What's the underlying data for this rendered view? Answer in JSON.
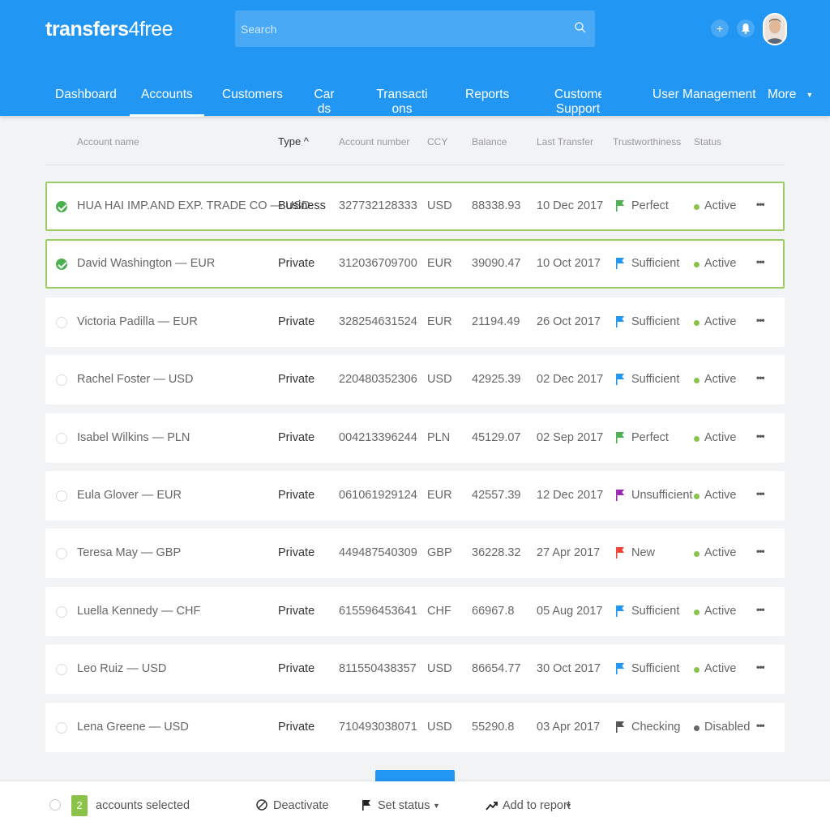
{
  "header": {
    "logo_part1": "transfers",
    "logo_part2": "4free",
    "search_placeholder": "Search",
    "add_label": "+",
    "accent": "#2196f3"
  },
  "nav": {
    "items": [
      {
        "label": "Dashboard"
      },
      {
        "label": "Accounts"
      },
      {
        "label": "Customers"
      },
      {
        "label": "Cards"
      },
      {
        "label": "Transactions"
      },
      {
        "label": "Reports"
      },
      {
        "label": "Customer Support"
      },
      {
        "label": "User Management"
      },
      {
        "label": "More"
      }
    ],
    "active": "Accounts"
  },
  "table": {
    "columns": [
      "Account name",
      "Type ^",
      "Account number",
      "CCY",
      "Balance",
      "Last Transfer",
      "Trustworthiness",
      "Status"
    ],
    "rows": [
      {
        "selected": true,
        "name": "HUA HAI IMP.AND EXP. TRADE CO — USD",
        "type": "Business",
        "number": "327732128333",
        "ccy": "USD",
        "balance": "88338.93",
        "last": "10 Dec 2017",
        "trust": "Perfect",
        "flag": "#4caf50",
        "status": "Active",
        "status_color": "#8bc34a",
        "more": "•••"
      },
      {
        "selected": true,
        "name": "David Washington — EUR",
        "type": "Private",
        "number": "312036709700",
        "ccy": "EUR",
        "balance": "39090.47",
        "last": "10 Oct 2017",
        "trust": "Sufficient",
        "flag": "#2196f3",
        "status": "Active",
        "status_color": "#8bc34a",
        "more": "•••"
      },
      {
        "selected": false,
        "name": "Victoria Padilla — EUR",
        "type": "Private",
        "number": "328254631524",
        "ccy": "EUR",
        "balance": "21194.49",
        "last": "26 Oct 2017",
        "trust": "Sufficient",
        "flag": "#2196f3",
        "status": "Active",
        "status_color": "#8bc34a",
        "more": "•••"
      },
      {
        "selected": false,
        "name": "Rachel Foster — USD",
        "type": "Private",
        "number": "220480352306",
        "ccy": "USD",
        "balance": "42925.39",
        "last": "02 Dec 2017",
        "trust": "Sufficient",
        "flag": "#2196f3",
        "status": "Active",
        "status_color": "#8bc34a",
        "more": "•••"
      },
      {
        "selected": false,
        "name": "Isabel Wilkins — PLN",
        "type": "Private",
        "number": "004213396244",
        "ccy": "PLN",
        "balance": "45129.07",
        "last": "02 Sep 2017",
        "trust": "Perfect",
        "flag": "#4caf50",
        "status": "Active",
        "status_color": "#8bc34a",
        "more": "•••"
      },
      {
        "selected": false,
        "name": "Eula Glover — EUR",
        "type": "Private",
        "number": "061061929124",
        "ccy": "EUR",
        "balance": "42557.39",
        "last": "12 Dec 2017",
        "trust": "Unsufficient",
        "flag": "#9c27b0",
        "status": "Active",
        "status_color": "#8bc34a",
        "more": "•••"
      },
      {
        "selected": false,
        "name": "Teresa May — GBP",
        "type": "Private",
        "number": "449487540309",
        "ccy": "GBP",
        "balance": "36228.32",
        "last": "27 Apr 2017",
        "trust": "New",
        "flag": "#f44336",
        "status": "Active",
        "status_color": "#8bc34a",
        "more": "•••"
      },
      {
        "selected": false,
        "name": "Luella Kennedy — CHF",
        "type": "Private",
        "number": "615596453641",
        "ccy": "CHF",
        "balance": "66967.8",
        "last": "05 Aug 2017",
        "trust": "Sufficient",
        "flag": "#2196f3",
        "status": "Active",
        "status_color": "#8bc34a",
        "more": "•••"
      },
      {
        "selected": false,
        "name": "Leo Ruiz — USD",
        "type": "Private",
        "number": "811550438357",
        "ccy": "USD",
        "balance": "86654.77",
        "last": "30 Oct 2017",
        "trust": "Sufficient",
        "flag": "#2196f3",
        "status": "Active",
        "status_color": "#8bc34a",
        "more": "•••"
      },
      {
        "selected": false,
        "name": "Lena Greene — USD",
        "type": "Private",
        "number": "710493038071",
        "ccy": "USD",
        "balance": "55290.8",
        "last": "03 Apr 2017",
        "trust": "Checking",
        "flag": "#555555",
        "status": "Disabled",
        "status_color": "#666666",
        "more": "•••"
      }
    ]
  },
  "bottom": {
    "count": "2",
    "selected_label": "accounts selected",
    "deactivate_label": "Deactivate",
    "set_status_label": "Set status",
    "add_report_label": "Add to report"
  }
}
